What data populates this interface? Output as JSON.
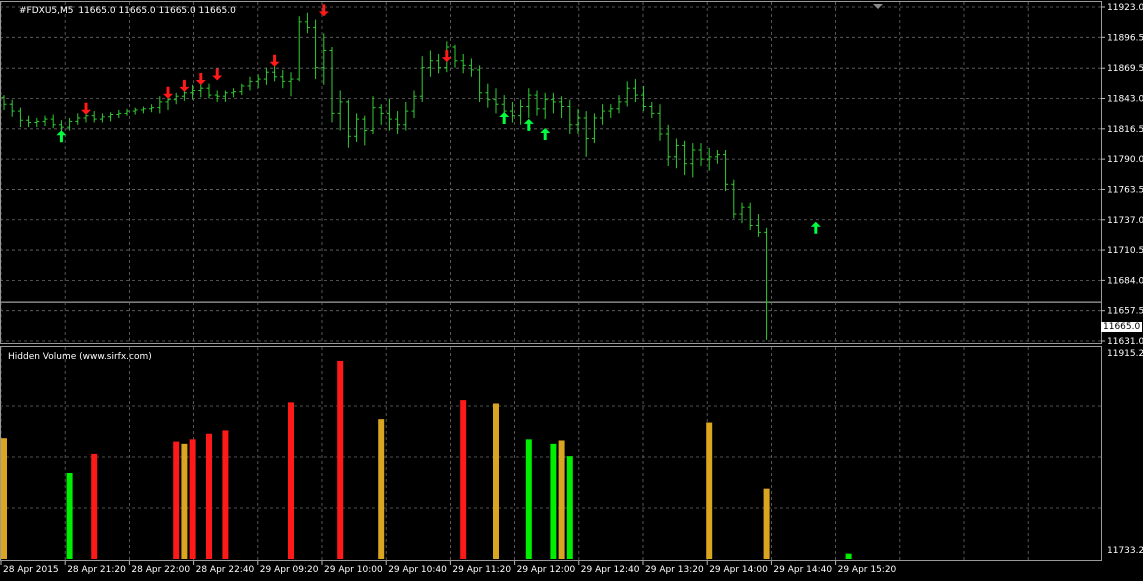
{
  "header": {
    "symbol": "#FDXU5,M5",
    "ohlc": "11665.0 11665.0 11665.0 11665.0"
  },
  "indicator": {
    "title": "Hidden Volume (www.sirfx.com)",
    "scale_top": "11915.27",
    "scale_bottom": "11733.22"
  },
  "current_price_label": "11665.0",
  "colors": {
    "background": "#000000",
    "grid": "#6b6b6b",
    "candle": "#32cd32",
    "up_arrow": "#00ff40",
    "down_arrow": "#ff1a1a",
    "vol_red": "#ff1a1a",
    "vol_green": "#00ee00",
    "vol_orange": "#daa520",
    "text": "#ffffff"
  },
  "chart_data": [
    {
      "type": "bar",
      "title": "#FDXU5,M5",
      "subtitle": "11665.0 11665.0 11665.0 11665.0",
      "ylim": [
        11631.0,
        11923.0
      ],
      "y_ticks": [
        "11923.0",
        "11896.5",
        "11869.5",
        "11843.0",
        "11816.5",
        "11790.0",
        "11763.5",
        "11737.0",
        "11710.5",
        "11684.0",
        "11657.5",
        "11631.0"
      ],
      "x_ticks": [
        "28 Apr 2015",
        "28 Apr 21:20",
        "28 Apr 22:00",
        "28 Apr 22:40",
        "29 Apr 09:20",
        "29 Apr 10:00",
        "29 Apr 10:40",
        "29 Apr 11:20",
        "29 Apr 12:00",
        "29 Apr 12:40",
        "29 Apr 13:20",
        "29 Apr 14:00",
        "29 Apr 14:40",
        "29 Apr 15:20"
      ],
      "current_price": 11665.0,
      "grid": true,
      "series": [
        {
          "values": [
            {
              "o": 11844,
              "h": 11846,
              "l": 11833,
              "c": 11838
            },
            {
              "o": 11838,
              "h": 11842,
              "l": 11827,
              "c": 11832
            },
            {
              "o": 11832,
              "h": 11835,
              "l": 11818,
              "c": 11824
            },
            {
              "o": 11824,
              "h": 11828,
              "l": 11818,
              "c": 11822
            },
            {
              "o": 11822,
              "h": 11826,
              "l": 11818,
              "c": 11823
            },
            {
              "o": 11823,
              "h": 11828,
              "l": 11819,
              "c": 11825
            },
            {
              "o": 11825,
              "h": 11829,
              "l": 11817,
              "c": 11820
            },
            {
              "o": 11820,
              "h": 11824,
              "l": 11812,
              "c": 11818
            },
            {
              "o": 11818,
              "h": 11826,
              "l": 11815,
              "c": 11823
            },
            {
              "o": 11823,
              "h": 11830,
              "l": 11820,
              "c": 11826
            },
            {
              "o": 11826,
              "h": 11832,
              "l": 11822,
              "c": 11828
            },
            {
              "o": 11828,
              "h": 11832,
              "l": 11822,
              "c": 11825
            },
            {
              "o": 11825,
              "h": 11830,
              "l": 11822,
              "c": 11827
            },
            {
              "o": 11827,
              "h": 11831,
              "l": 11823,
              "c": 11829
            },
            {
              "o": 11829,
              "h": 11833,
              "l": 11826,
              "c": 11830
            },
            {
              "o": 11830,
              "h": 11834,
              "l": 11828,
              "c": 11832
            },
            {
              "o": 11832,
              "h": 11835,
              "l": 11829,
              "c": 11833
            },
            {
              "o": 11833,
              "h": 11836,
              "l": 11830,
              "c": 11834
            },
            {
              "o": 11834,
              "h": 11838,
              "l": 11831,
              "c": 11835
            },
            {
              "o": 11835,
              "h": 11845,
              "l": 11830,
              "c": 11840
            },
            {
              "o": 11840,
              "h": 11846,
              "l": 11833,
              "c": 11842
            },
            {
              "o": 11842,
              "h": 11848,
              "l": 11838,
              "c": 11845
            },
            {
              "o": 11845,
              "h": 11852,
              "l": 11841,
              "c": 11848
            },
            {
              "o": 11848,
              "h": 11855,
              "l": 11842,
              "c": 11850
            },
            {
              "o": 11850,
              "h": 11858,
              "l": 11844,
              "c": 11852
            },
            {
              "o": 11852,
              "h": 11856,
              "l": 11843,
              "c": 11846
            },
            {
              "o": 11846,
              "h": 11850,
              "l": 11840,
              "c": 11845
            },
            {
              "o": 11845,
              "h": 11850,
              "l": 11840,
              "c": 11848
            },
            {
              "o": 11848,
              "h": 11852,
              "l": 11844,
              "c": 11849
            },
            {
              "o": 11849,
              "h": 11856,
              "l": 11846,
              "c": 11854
            },
            {
              "o": 11854,
              "h": 11862,
              "l": 11850,
              "c": 11858
            },
            {
              "o": 11858,
              "h": 11864,
              "l": 11852,
              "c": 11860
            },
            {
              "o": 11860,
              "h": 11870,
              "l": 11855,
              "c": 11866
            },
            {
              "o": 11866,
              "h": 11872,
              "l": 11858,
              "c": 11862
            },
            {
              "o": 11862,
              "h": 11868,
              "l": 11852,
              "c": 11858
            },
            {
              "o": 11858,
              "h": 11866,
              "l": 11845,
              "c": 11860
            },
            {
              "o": 11860,
              "h": 11915,
              "l": 11858,
              "c": 11910
            },
            {
              "o": 11910,
              "h": 11918,
              "l": 11900,
              "c": 11905
            },
            {
              "o": 11905,
              "h": 11912,
              "l": 11860,
              "c": 11870
            },
            {
              "o": 11870,
              "h": 11900,
              "l": 11855,
              "c": 11885
            },
            {
              "o": 11885,
              "h": 11888,
              "l": 11822,
              "c": 11830
            },
            {
              "o": 11830,
              "h": 11850,
              "l": 11815,
              "c": 11840
            },
            {
              "o": 11840,
              "h": 11842,
              "l": 11800,
              "c": 11810
            },
            {
              "o": 11810,
              "h": 11830,
              "l": 11805,
              "c": 11825
            },
            {
              "o": 11825,
              "h": 11828,
              "l": 11802,
              "c": 11815
            },
            {
              "o": 11815,
              "h": 11845,
              "l": 11812,
              "c": 11835
            },
            {
              "o": 11835,
              "h": 11838,
              "l": 11820,
              "c": 11830
            },
            {
              "o": 11830,
              "h": 11843,
              "l": 11815,
              "c": 11825
            },
            {
              "o": 11825,
              "h": 11832,
              "l": 11812,
              "c": 11820
            },
            {
              "o": 11820,
              "h": 11840,
              "l": 11815,
              "c": 11832
            },
            {
              "o": 11832,
              "h": 11850,
              "l": 11826,
              "c": 11845
            },
            {
              "o": 11845,
              "h": 11880,
              "l": 11840,
              "c": 11870
            },
            {
              "o": 11870,
              "h": 11885,
              "l": 11862,
              "c": 11876
            },
            {
              "o": 11876,
              "h": 11882,
              "l": 11865,
              "c": 11870
            },
            {
              "o": 11870,
              "h": 11893,
              "l": 11866,
              "c": 11888
            },
            {
              "o": 11888,
              "h": 11890,
              "l": 11870,
              "c": 11876
            },
            {
              "o": 11876,
              "h": 11882,
              "l": 11865,
              "c": 11872
            },
            {
              "o": 11872,
              "h": 11878,
              "l": 11862,
              "c": 11868
            },
            {
              "o": 11868,
              "h": 11872,
              "l": 11840,
              "c": 11848
            },
            {
              "o": 11848,
              "h": 11856,
              "l": 11835,
              "c": 11842
            },
            {
              "o": 11842,
              "h": 11852,
              "l": 11830,
              "c": 11838
            },
            {
              "o": 11838,
              "h": 11846,
              "l": 11826,
              "c": 11832
            },
            {
              "o": 11832,
              "h": 11840,
              "l": 11822,
              "c": 11828
            },
            {
              "o": 11828,
              "h": 11842,
              "l": 11820,
              "c": 11836
            },
            {
              "o": 11836,
              "h": 11852,
              "l": 11826,
              "c": 11846
            },
            {
              "o": 11846,
              "h": 11850,
              "l": 11828,
              "c": 11834
            },
            {
              "o": 11834,
              "h": 11848,
              "l": 11825,
              "c": 11842
            },
            {
              "o": 11842,
              "h": 11848,
              "l": 11830,
              "c": 11840
            },
            {
              "o": 11840,
              "h": 11845,
              "l": 11826,
              "c": 11836
            },
            {
              "o": 11836,
              "h": 11842,
              "l": 11812,
              "c": 11820
            },
            {
              "o": 11820,
              "h": 11834,
              "l": 11812,
              "c": 11826
            },
            {
              "o": 11826,
              "h": 11832,
              "l": 11792,
              "c": 11808
            },
            {
              "o": 11808,
              "h": 11830,
              "l": 11804,
              "c": 11826
            },
            {
              "o": 11826,
              "h": 11838,
              "l": 11820,
              "c": 11832
            },
            {
              "o": 11832,
              "h": 11838,
              "l": 11826,
              "c": 11834
            },
            {
              "o": 11834,
              "h": 11846,
              "l": 11830,
              "c": 11840
            },
            {
              "o": 11840,
              "h": 11858,
              "l": 11836,
              "c": 11852
            },
            {
              "o": 11852,
              "h": 11860,
              "l": 11840,
              "c": 11846
            },
            {
              "o": 11846,
              "h": 11854,
              "l": 11832,
              "c": 11836
            },
            {
              "o": 11836,
              "h": 11840,
              "l": 11826,
              "c": 11830
            },
            {
              "o": 11830,
              "h": 11838,
              "l": 11806,
              "c": 11812
            },
            {
              "o": 11812,
              "h": 11820,
              "l": 11784,
              "c": 11792
            },
            {
              "o": 11792,
              "h": 11808,
              "l": 11782,
              "c": 11802
            },
            {
              "o": 11802,
              "h": 11806,
              "l": 11776,
              "c": 11786
            },
            {
              "o": 11786,
              "h": 11804,
              "l": 11774,
              "c": 11798
            },
            {
              "o": 11798,
              "h": 11804,
              "l": 11784,
              "c": 11790
            },
            {
              "o": 11790,
              "h": 11800,
              "l": 11780,
              "c": 11792
            },
            {
              "o": 11792,
              "h": 11798,
              "l": 11786,
              "c": 11794
            },
            {
              "o": 11794,
              "h": 11798,
              "l": 11762,
              "c": 11768
            },
            {
              "o": 11768,
              "h": 11772,
              "l": 11738,
              "c": 11742
            },
            {
              "o": 11742,
              "h": 11752,
              "l": 11734,
              "c": 11748
            },
            {
              "o": 11748,
              "h": 11752,
              "l": 11728,
              "c": 11732
            },
            {
              "o": 11732,
              "h": 11742,
              "l": 11722,
              "c": 11726
            },
            {
              "o": 11726,
              "h": 11730,
              "l": 11632,
              "c": 11665
            }
          ]
        }
      ],
      "arrows": [
        {
          "bar": 7,
          "dir": "up",
          "price": 11810
        },
        {
          "bar": 10,
          "dir": "down",
          "price": 11834
        },
        {
          "bar": 20,
          "dir": "down",
          "price": 11848
        },
        {
          "bar": 22,
          "dir": "down",
          "price": 11854
        },
        {
          "bar": 24,
          "dir": "down",
          "price": 11860
        },
        {
          "bar": 26,
          "dir": "down",
          "price": 11864
        },
        {
          "bar": 33,
          "dir": "down",
          "price": 11876
        },
        {
          "bar": 39,
          "dir": "down",
          "price": 11920
        },
        {
          "bar": 54,
          "dir": "down",
          "price": 11880
        },
        {
          "bar": 61,
          "dir": "up",
          "price": 11826
        },
        {
          "bar": 64,
          "dir": "up",
          "price": 11820
        },
        {
          "bar": 66,
          "dir": "up",
          "price": 11812
        },
        {
          "bar": 99,
          "dir": "up",
          "price": 11730
        }
      ]
    },
    {
      "type": "bar",
      "title": "Hidden Volume (www.sirfx.com)",
      "ylim": [
        11733.22,
        11915.27
      ],
      "y_ticks": [
        "11915.27",
        "11733.22"
      ],
      "series": [
        {
          "values": [
            {
              "bar": 0,
              "value": 11841,
              "color": "orange"
            },
            {
              "bar": 8,
              "value": 11810,
              "color": "green"
            },
            {
              "bar": 11,
              "value": 11827,
              "color": "red"
            },
            {
              "bar": 21,
              "value": 11838,
              "color": "red"
            },
            {
              "bar": 22,
              "value": 11836,
              "color": "orange"
            },
            {
              "bar": 23,
              "value": 11840,
              "color": "red"
            },
            {
              "bar": 25,
              "value": 11845,
              "color": "red"
            },
            {
              "bar": 27,
              "value": 11848,
              "color": "red"
            },
            {
              "bar": 35,
              "value": 11873,
              "color": "red"
            },
            {
              "bar": 41,
              "value": 11910,
              "color": "red"
            },
            {
              "bar": 46,
              "value": 11858,
              "color": "orange"
            },
            {
              "bar": 56,
              "value": 11875,
              "color": "red"
            },
            {
              "bar": 60,
              "value": 11872,
              "color": "orange"
            },
            {
              "bar": 64,
              "value": 11840,
              "color": "green"
            },
            {
              "bar": 67,
              "value": 11836,
              "color": "green"
            },
            {
              "bar": 68,
              "value": 11839,
              "color": "orange"
            },
            {
              "bar": 69,
              "value": 11825,
              "color": "green"
            },
            {
              "bar": 86,
              "value": 11855,
              "color": "orange"
            },
            {
              "bar": 93,
              "value": 11796,
              "color": "orange"
            },
            {
              "bar": 103,
              "value": 11738,
              "color": "green"
            }
          ]
        }
      ]
    }
  ]
}
